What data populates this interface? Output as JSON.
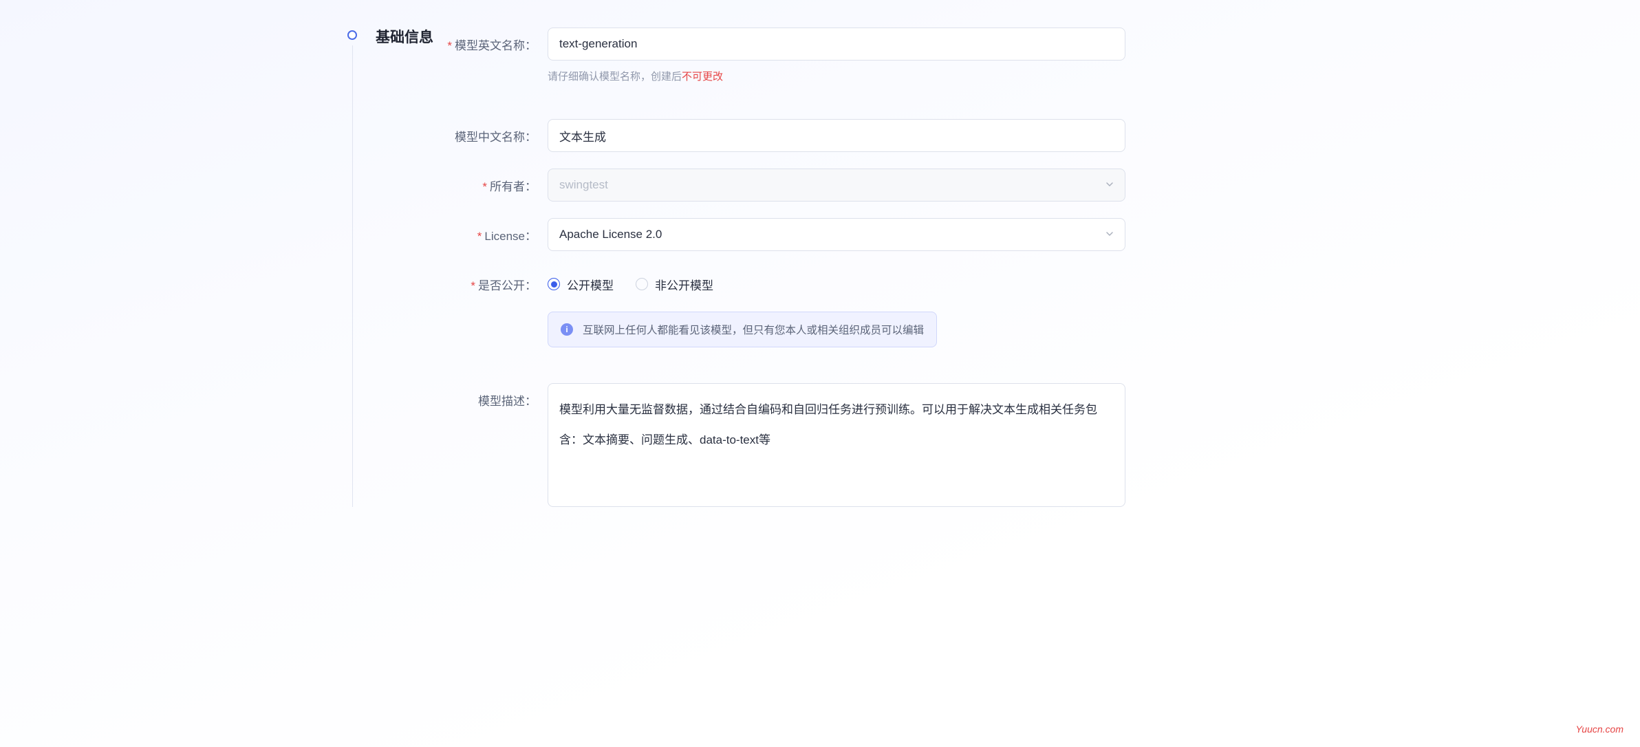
{
  "section_title": "基础信息",
  "fields": {
    "english_name": {
      "label": "模型英文名称：",
      "value": "text-generation",
      "helper_prefix": "请仔细确认模型名称，创建后",
      "helper_danger": "不可更改"
    },
    "chinese_name": {
      "label": "模型中文名称：",
      "value": "文本生成"
    },
    "owner": {
      "label": "所有者：",
      "value": "swingtest"
    },
    "license": {
      "label": "License：",
      "value": "Apache License 2.0"
    },
    "visibility": {
      "label": "是否公开：",
      "option_public": "公开模型",
      "option_private": "非公开模型",
      "selected": "public",
      "info": "互联网上任何人都能看见该模型，但只有您本人或相关组织成员可以编辑"
    },
    "description": {
      "label": "模型描述：",
      "value": "模型利用大量无监督数据，通过结合自编码和自回归任务进行预训练。可以用于解决文本生成相关任务包含：文本摘要、问题生成、data-to-text等"
    }
  },
  "watermark": "Yuucn.com"
}
